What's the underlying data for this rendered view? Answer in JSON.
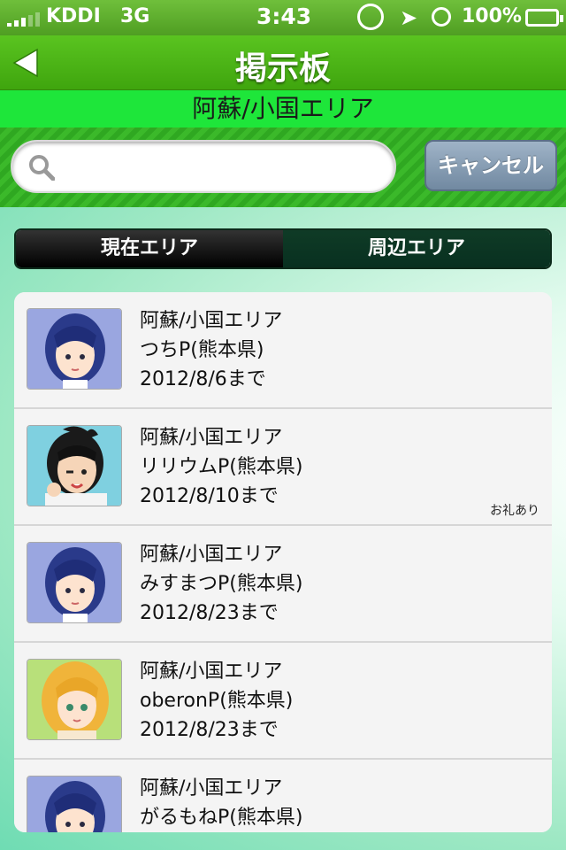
{
  "status_bar": {
    "carrier": "KDDI",
    "network": "3G",
    "time": "3:43",
    "battery": "100%",
    "icons": [
      "signal-icon",
      "rotation-lock-icon",
      "location-icon",
      "alarm-icon",
      "battery-icon"
    ]
  },
  "nav": {
    "title": "掲示板",
    "back_icon": "back-arrow-icon"
  },
  "area": {
    "name": "阿蘇/小国エリア"
  },
  "search": {
    "value": "",
    "placeholder": "",
    "cancel_label": "キャンセル"
  },
  "tabs": [
    {
      "label": "現在エリア",
      "selected": true
    },
    {
      "label": "周辺エリア",
      "selected": false
    }
  ],
  "posts": [
    {
      "area": "阿蘇/小国エリア",
      "author": "つちP(熊本県)",
      "deadline": "2012/8/6まで",
      "badge": "",
      "avatar": "blue-hair-character"
    },
    {
      "area": "阿蘇/小国エリア",
      "author": "リリウムP(熊本県)",
      "deadline": "2012/8/10まで",
      "badge": "お礼あり",
      "avatar": "black-ponytail-character"
    },
    {
      "area": "阿蘇/小国エリア",
      "author": "みすまつP(熊本県)",
      "deadline": "2012/8/23まで",
      "badge": "",
      "avatar": "blue-hair-character"
    },
    {
      "area": "阿蘇/小国エリア",
      "author": "oberonP(熊本県)",
      "deadline": "2012/8/23まで",
      "badge": "",
      "avatar": "blonde-hair-character"
    },
    {
      "area": "阿蘇/小国エリア",
      "author": "がるもねP(熊本県)",
      "deadline": "",
      "badge": "",
      "avatar": "blue-hair-character"
    }
  ],
  "colors": {
    "nav_green": "#4fb21a",
    "area_bar_green": "#1ee63a",
    "segment_dark": "#000000",
    "segment_selected_green": "#083020"
  }
}
